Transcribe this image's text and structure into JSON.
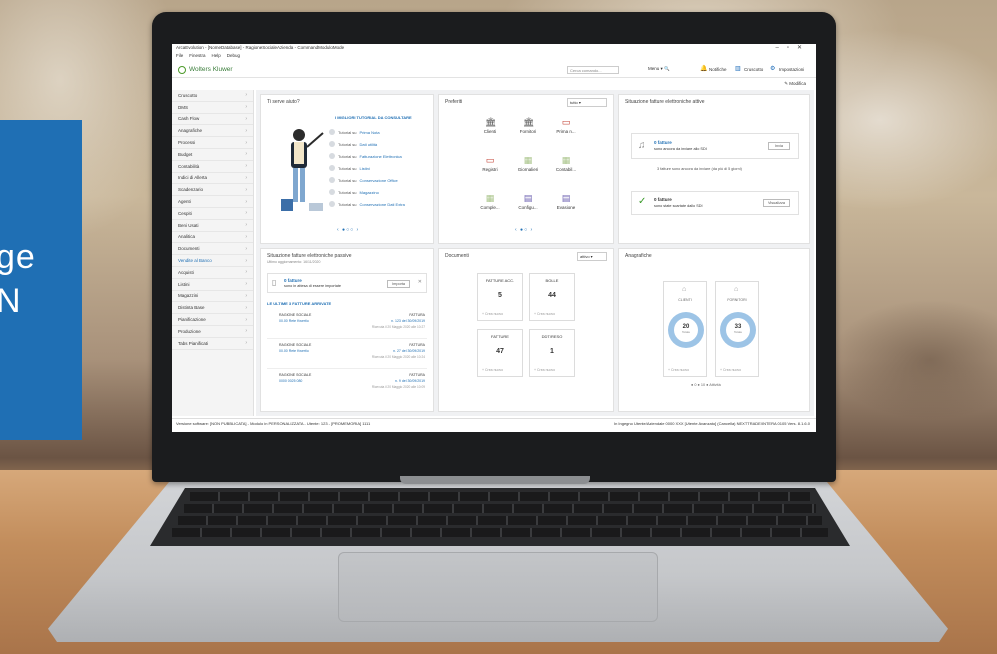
{
  "promo": {
    "line1": "ge",
    "line2": "N"
  },
  "app": {
    "title": "ArcaEvolution - [NomeDatabase] - RagioneSocialeAzienda - CommandModuloMode",
    "menu": [
      "File",
      "Finestra",
      "Help",
      "Debug"
    ],
    "brand": "Wolters Kluwer",
    "search_placeholder": "Cerca comando...",
    "menu_select": "Menu",
    "notifications": "Notifiche",
    "cruscotto": "Cruscotto",
    "impostazioni": "Impostazioni",
    "modifica": "Modifica"
  },
  "sidebar": {
    "items": [
      {
        "label": "Cruscotto"
      },
      {
        "label": "DMS"
      },
      {
        "label": "Cash Flow"
      },
      {
        "label": "Anagrafiche"
      },
      {
        "label": "Processi"
      },
      {
        "label": "Budget"
      },
      {
        "label": "Contabilità"
      },
      {
        "label": "Indici di Allerta"
      },
      {
        "label": "Scadenzario"
      },
      {
        "label": "Agenti"
      },
      {
        "label": "Cespiti"
      },
      {
        "label": "Beni Usati"
      },
      {
        "label": "Analitica"
      },
      {
        "label": "Documenti"
      },
      {
        "label": "Vendite al Banco"
      },
      {
        "label": "Acquisti"
      },
      {
        "label": "Listini"
      },
      {
        "label": "Magazzini"
      },
      {
        "label": "Distinta Base"
      },
      {
        "label": "Pianificazione"
      },
      {
        "label": "Produzione"
      },
      {
        "label": "Tabs Pianificati"
      }
    ]
  },
  "cards": {
    "tutorial": {
      "title": "Ti serve aiuto?",
      "heading": "I MIGLIORI TUTORIAL DA CONSULTARE",
      "items": [
        {
          "prefix": "Tutorial su",
          "link": "Prima Nota"
        },
        {
          "prefix": "Tutorial su",
          "link": "Dati utilità"
        },
        {
          "prefix": "Tutorial su",
          "link": "Fatturazione Elettronica"
        },
        {
          "prefix": "Tutorial su",
          "link": "Listini"
        },
        {
          "prefix": "Tutorial su",
          "link": "Conservazione Office"
        },
        {
          "prefix": "Tutorial su",
          "link": "Magazzino"
        },
        {
          "prefix": "Tutorial su",
          "link": "Conservazione Dati Extra"
        }
      ],
      "pager": "‹ ●○○ ›"
    },
    "favorites": {
      "title": "Preferiti",
      "select": "tutto",
      "items": [
        {
          "label": "Clienti",
          "icon": "clients-icon",
          "glyph": "🏛"
        },
        {
          "label": "Fornitori",
          "icon": "suppliers-icon",
          "glyph": "🏛"
        },
        {
          "label": "Prima n...",
          "icon": "journal-icon",
          "glyph": "▭"
        },
        {
          "label": "Registri",
          "icon": "registers-icon",
          "glyph": "▭"
        },
        {
          "label": "Giornalieri",
          "icon": "daily-icon",
          "glyph": "▦"
        },
        {
          "label": "Contabil...",
          "icon": "accounting-icon",
          "glyph": "▦"
        },
        {
          "label": "Comple...",
          "icon": "complete-icon",
          "glyph": "▦"
        },
        {
          "label": "Configu...",
          "icon": "config-icon",
          "glyph": "▤"
        },
        {
          "label": "Evasione",
          "icon": "dispatch-icon",
          "glyph": "▤"
        }
      ],
      "pager": "‹ ●○ ›"
    },
    "einvoice_active": {
      "title": "Situazione fatture elettroniche attive",
      "box1_count": "0 fatture",
      "box1_text": "sono ancora da inviare allo SDI",
      "box1_button": "Invia",
      "note": "3 fatture sono ancora da inviare (da più di 5 giorni)",
      "box2_count": "0 fatture",
      "box2_text": "sono state scartate dallo SDI",
      "box2_button": "Visualizza"
    },
    "einvoice_passive": {
      "title": "Situazione fatture elettroniche passive",
      "subtitle": "Ultimo aggiornamento: 16/11/2020",
      "box_count": "0 fatture",
      "box_text": "sono in attesa di essere importate",
      "box_button": "Importa",
      "section": "LE ULTIME 3 FATTURE ARRIVATE",
      "rows": [
        {
          "left1": "RAGIONE SOCIALE",
          "left2": "00.00 Rete Kwertio",
          "right1": "FATTURA",
          "right2": "n. 123 del 30/09/2019",
          "right3": "Ricevuta il 20 Maggio 2020 alle 10:27"
        },
        {
          "left1": "RAGIONE SOCIALE",
          "left2": "00.00 Rete Kwertio",
          "right1": "FATTURA",
          "right2": "n. 27 del 30/09/2019",
          "right3": "Ricevuta il 20 Maggio 2020 alle 10:24"
        },
        {
          "left1": "RAGIONE SOCIALE",
          "left2": "0000 0025 080",
          "right1": "FATTURA",
          "right2": "n. 9 del 30/09/2019",
          "right3": "Ricevuta il 20 Maggio 2020 alle 10:09"
        }
      ]
    },
    "documents": {
      "title": "Documenti",
      "select": "attivo",
      "boxes": [
        {
          "title": "FATTURE ACC.",
          "value": "5",
          "link": "+ Crea nuovo"
        },
        {
          "title": "BOLLE",
          "value": "44",
          "link": "+ Crea nuovo"
        },
        {
          "title": "FATTURE",
          "value": "47",
          "link": "+ Crea nuovo"
        },
        {
          "title": "DDT/RESO",
          "value": "1",
          "link": "+ Crea nuovo"
        }
      ]
    },
    "anagrafiche": {
      "title": "Anagrafiche",
      "boxes": [
        {
          "title": "CLIENTI",
          "value": "20",
          "sub": "Totale",
          "link": "+ Crea nuovo"
        },
        {
          "title": "FORNITORI",
          "value": "33",
          "sub": "Totale",
          "link": "+ Crea nuovo"
        }
      ],
      "legend": "● 0  ● 10  ● Attività"
    }
  },
  "status_bar": {
    "left": "Versione software: [NON PUBBLICATA] - Modulo in PERSONALIZZATA - Utente: 123 - [PROMEMORIA] 1111",
    "right": "In Ingegno  Utente/Aziendale 0000 XXX [Utente Avanzato] (Cancella)  NEXTTRADE/INTERA 0105  Vers. 8.1.6.0"
  },
  "colors": {
    "accent": "#1f6fb4",
    "brand_green": "#4c9a2a",
    "donut_ring": "#9dc4e6",
    "success": "#3a9a2a",
    "danger": "#c0392b"
  }
}
